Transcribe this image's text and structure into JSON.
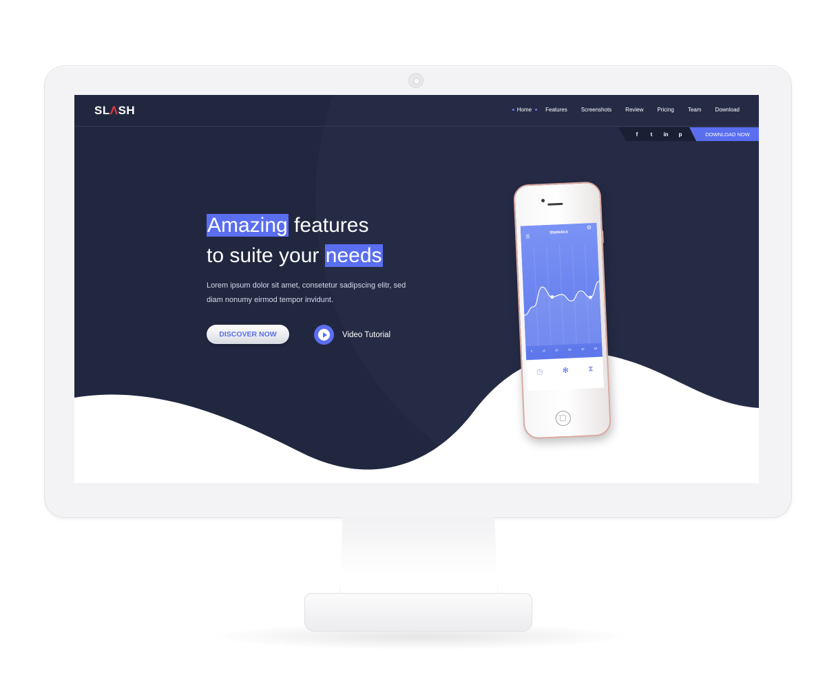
{
  "brand": {
    "logo_text_1": "SL",
    "logo_text_accent": "Λ",
    "logo_text_2": "SH"
  },
  "nav": {
    "items": [
      {
        "label": "Home",
        "active": true
      },
      {
        "label": "Features"
      },
      {
        "label": "Screenshots"
      },
      {
        "label": "Review"
      },
      {
        "label": "Pricing"
      },
      {
        "label": "Team"
      },
      {
        "label": "Download"
      }
    ]
  },
  "social": {
    "icons": [
      "f",
      "t",
      "in",
      "p"
    ],
    "icon_names": [
      "facebook-icon",
      "twitter-icon",
      "linkedin-icon",
      "pinterest-icon"
    ]
  },
  "download_button": "DOWNLOAD NOW",
  "hero": {
    "title_hl_1": "Amazing",
    "title_rest_1": " features",
    "title_line_2": "to suite your ",
    "title_hl_2": "needs",
    "text": "Lorem ipsum dolor sit amet, consetetur sadipscing elitr, sed diam nonumy eirmod tempor invidunt.",
    "discover_button": "DISCOVER NOW",
    "video_label": "Video Tutorial"
  },
  "phone": {
    "app_title": "Statistics",
    "ticks": [
      "0",
      "10",
      "20",
      "30",
      "40",
      "50"
    ],
    "chart_values": [
      30,
      42,
      70,
      55,
      58,
      48,
      62,
      52,
      75
    ]
  },
  "colors": {
    "accent": "#5a6ef0",
    "screen_bg": "#222740",
    "logo_accent": "#e23b3b"
  }
}
